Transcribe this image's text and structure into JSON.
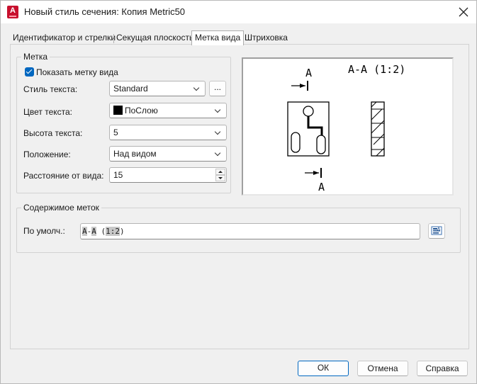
{
  "window": {
    "title": "Новый стиль сечения: Копия Metric50",
    "app_icon_letter": "A"
  },
  "tabs": [
    {
      "label": "Идентификатор и стрелки",
      "active": false
    },
    {
      "label": "Секущая плоскость",
      "active": false
    },
    {
      "label": "Метка вида",
      "active": true
    },
    {
      "label": "Штриховка",
      "active": false
    }
  ],
  "label_group": {
    "title": "Метка",
    "show_label_checkbox": {
      "label": "Показать метку вида",
      "checked": true
    },
    "text_style": {
      "label": "Стиль текста:",
      "value": "Standard",
      "browse_label": "..."
    },
    "text_color": {
      "label": "Цвет текста:",
      "value": "ПоСлою",
      "swatch_color": "#000000"
    },
    "text_height": {
      "label": "Высота текста:",
      "value": "5"
    },
    "position": {
      "label": "Положение:",
      "value": "Над видом"
    },
    "offset": {
      "label": "Расстояние от вида:",
      "value": "15"
    }
  },
  "preview": {
    "title_text": "A-A (1:2)",
    "top_letter": "A",
    "bottom_letter": "A"
  },
  "content_group": {
    "title": "Содержимое меток",
    "default_label": "По умолч.:",
    "value_parts": [
      {
        "text": "A",
        "highlight": true
      },
      {
        "text": "-",
        "highlight": false
      },
      {
        "text": "A",
        "highlight": true
      },
      {
        "text": " (",
        "highlight": false
      },
      {
        "text": "1:2",
        "highlight": true
      },
      {
        "text": ")",
        "highlight": false
      }
    ],
    "field_icon": "field-editor-icon"
  },
  "footer": {
    "ok_label": "ОК",
    "cancel_label": "Отмена",
    "help_label": "Справка"
  },
  "colors": {
    "accent": "#0067c0",
    "app_icon": "#c8102e"
  }
}
